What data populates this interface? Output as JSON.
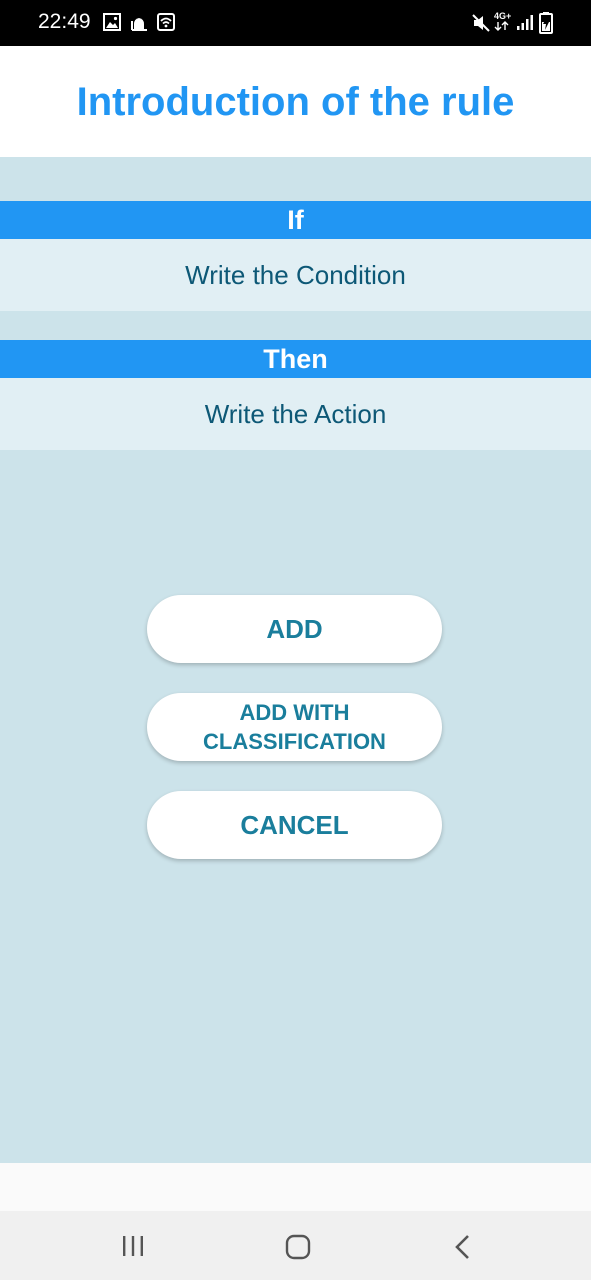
{
  "status_bar": {
    "time": "22:49",
    "network": "4G+",
    "left_icons": [
      "image-icon",
      "mosque-icon",
      "wifi-hotspot-icon"
    ],
    "right_icons": [
      "mute-icon",
      "network-type-icon",
      "signal-icon",
      "battery-icon"
    ]
  },
  "header": {
    "title": "Introduction of the rule",
    "title_color": "#2196f3"
  },
  "rule": {
    "if_label": "If",
    "condition_placeholder": "Write the Condition",
    "then_label": "Then",
    "action_placeholder": "Write the Action"
  },
  "buttons": {
    "add": "ADD",
    "add_with_classification_line1": "ADD WITH",
    "add_with_classification_line2": "CLASSIFICATION",
    "cancel": "CANCEL"
  },
  "nav_bar": {
    "icons": [
      "recent-apps-icon",
      "home-icon",
      "back-icon"
    ]
  },
  "colors": {
    "accent": "#2196f3",
    "background": "#cce3ea",
    "field_background": "#e1eff4",
    "field_text": "#0d5876",
    "button_text": "#1a7e9c"
  }
}
